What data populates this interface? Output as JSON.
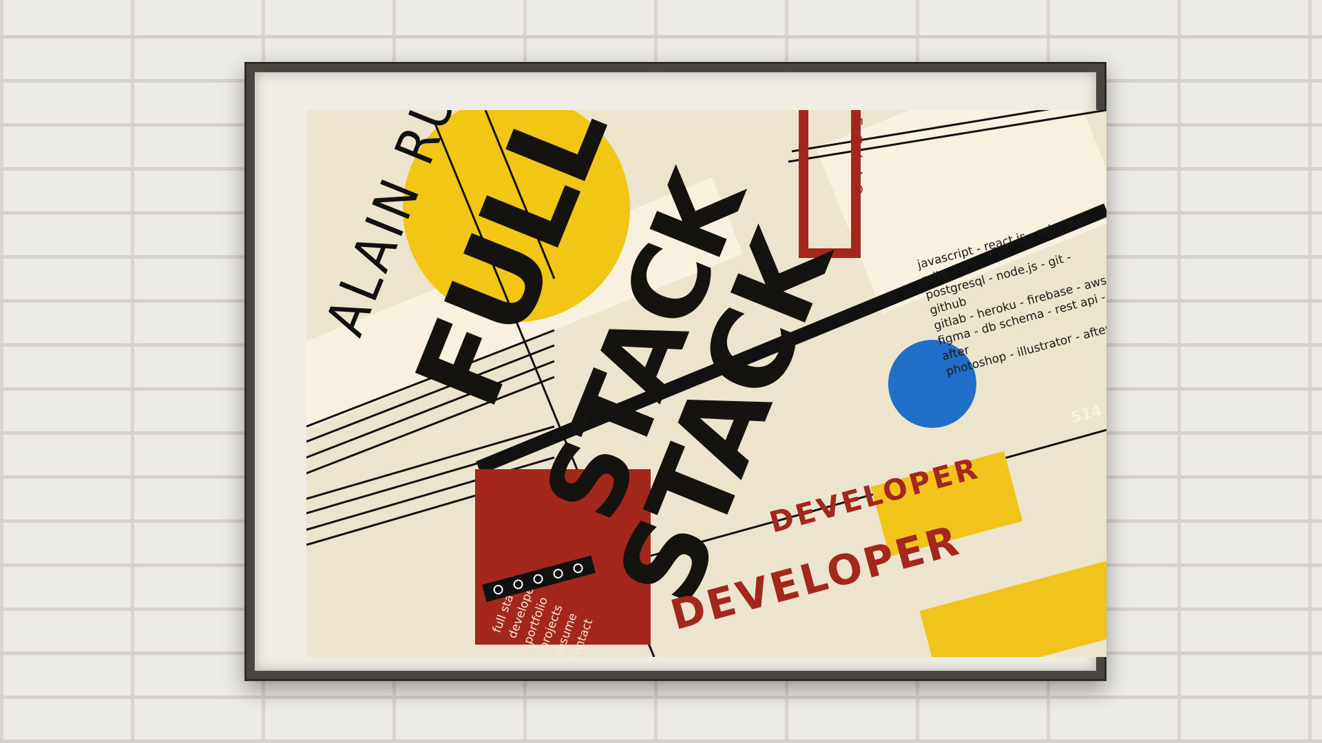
{
  "poster": {
    "name": "ALAIN RUSNOV",
    "title_line1": "FULL",
    "title_line2": "STACK",
    "title_line3": "STACK",
    "role": "DEVELOPER",
    "role_alt": "DEVELOPER",
    "folio": "FOLIO",
    "corner_number": "514",
    "skills": [
      "javascript - react.js - ruby on rails",
      "postgresql - node.js - git - github",
      "gitlab - heroku - firebase - aws",
      "figma - db schema - rest api - after",
      "photoshop - illustrator - after"
    ],
    "nav_items": [
      "full stack",
      "developer",
      "portfolio",
      "projects",
      "resume",
      "contact"
    ]
  },
  "colors": {
    "yellow": "#f2c614",
    "red": "#a3271c",
    "blue": "#1f6ec8",
    "paper": "#ede4cd",
    "ink": "#151310"
  }
}
